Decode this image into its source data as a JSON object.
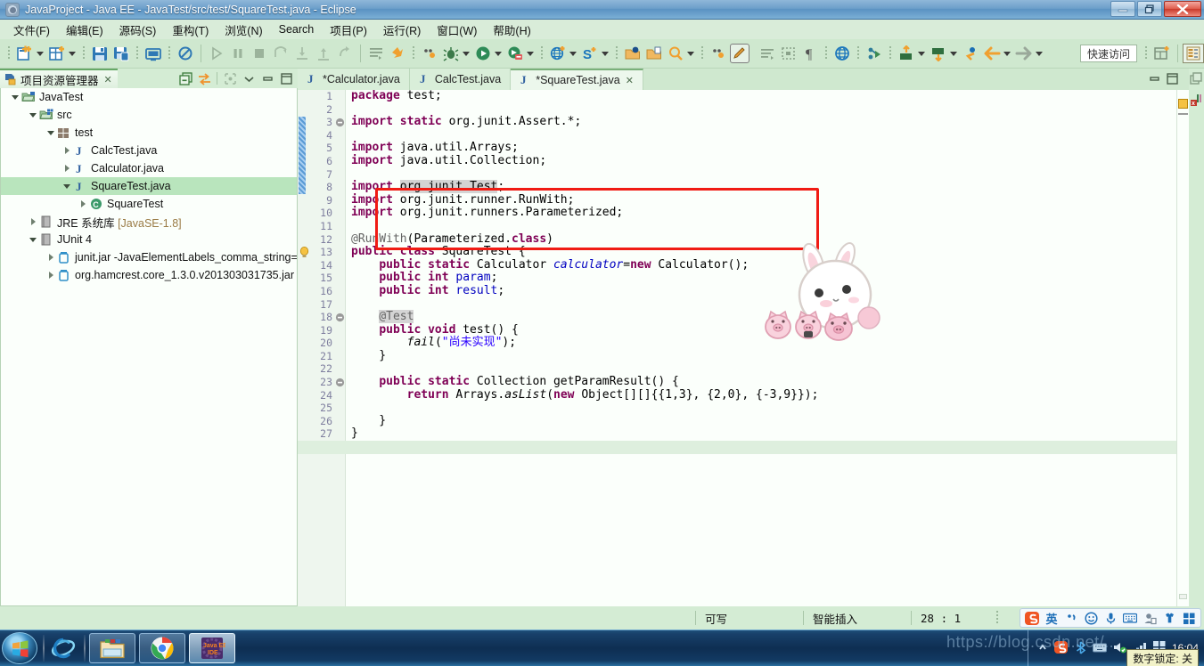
{
  "window": {
    "title": "JavaProject  -  Java EE  -  JavaTest/src/test/SquareTest.java  -  Eclipse",
    "app_icon": "eclipse-icon",
    "controls": {
      "minimize": "–",
      "restore": "❐",
      "close": "✕"
    }
  },
  "menubar": {
    "items": [
      "文件(F)",
      "编辑(E)",
      "源码(S)",
      "重构(T)",
      "浏览(N)",
      "Search",
      "项目(P)",
      "运行(R)",
      "窗口(W)",
      "帮助(H)"
    ]
  },
  "toolbar": {
    "quick_access_placeholder": "快速访问",
    "icons": [
      "new-wizard-icon",
      "new-dropdown-caret",
      "new-folder-icon",
      "new-folder-caret",
      "save-icon",
      "save-all-icon",
      "print-icon",
      "toggle-breakpoint-icon",
      "run-icon",
      "pause-icon",
      "stop-icon",
      "step-over-icon",
      "step-into-icon",
      "step-return-icon",
      "step-out-icon",
      "open-task-icon",
      "link-task-icon",
      "more-icon",
      "debug-icon",
      "debug-caret",
      "run-as-icon",
      "run-as-caret",
      "coverage-icon",
      "coverage-caret",
      "new-web-icon",
      "new-web-caret",
      "new-server-icon",
      "new-server-caret",
      "open-type-icon",
      "open-resource-icon",
      "search-icon",
      "search-caret",
      "more2-icon",
      "pencil-icon",
      "next-annotation-icon",
      "previous-annotation-icon",
      "pilcrow-icon",
      "globe-icon",
      "deploy-icon",
      "export-icon",
      "export-caret",
      "import-icon",
      "import-caret",
      "back-dot-icon",
      "back-arrow-icon",
      "back-caret",
      "forward-arrow-icon",
      "forward-caret"
    ],
    "perspective_new": "open-perspective-icon",
    "perspective_current": "java-ee-perspective-icon"
  },
  "project_explorer": {
    "tab_label": "项目资源管理器",
    "tab_close": "✕",
    "tools": [
      "collapse-all-icon",
      "link-with-editor-icon",
      "focus-on-active-task-icon",
      "view-menu-chevron-icon",
      "minimize-view-icon",
      "maximize-view-icon"
    ],
    "tree": [
      {
        "label": "JavaTest",
        "dim": "",
        "depth": 0,
        "twist": "open",
        "icon": "java-project-icon",
        "selected": false
      },
      {
        "label": "src",
        "dim": "",
        "depth": 1,
        "twist": "open",
        "icon": "source-folder-icon",
        "selected": false
      },
      {
        "label": "test",
        "dim": "",
        "depth": 2,
        "twist": "open",
        "icon": "package-icon",
        "selected": false
      },
      {
        "label": "CalcTest.java",
        "dim": "",
        "depth": 3,
        "twist": "closed",
        "icon": "java-file-icon",
        "selected": false
      },
      {
        "label": "Calculator.java",
        "dim": "",
        "depth": 3,
        "twist": "closed",
        "icon": "java-file-icon",
        "selected": false
      },
      {
        "label": "SquareTest.java",
        "dim": "",
        "depth": 3,
        "twist": "open",
        "icon": "java-file-icon",
        "selected": true
      },
      {
        "label": "SquareTest",
        "dim": "",
        "depth": 4,
        "twist": "closed",
        "icon": "java-class-icon",
        "selected": false
      },
      {
        "label": "JRE 系统库 ",
        "dim": "[JavaSE-1.8]",
        "depth": 1,
        "twist": "closed",
        "icon": "library-icon",
        "selected": false
      },
      {
        "label": "JUnit 4",
        "dim": "",
        "depth": 1,
        "twist": "open",
        "icon": "library-icon",
        "selected": false
      },
      {
        "label": "junit.jar -JavaElementLabels_comma_string=",
        "dim": "",
        "depth": 2,
        "twist": "closed",
        "icon": "jar-icon",
        "selected": false
      },
      {
        "label": "org.hamcrest.core_1.3.0.v201303031735.jar",
        "dim": "",
        "depth": 2,
        "twist": "closed",
        "icon": "jar-icon",
        "selected": false
      }
    ]
  },
  "editor": {
    "tabs": [
      {
        "label": "*Calculator.java",
        "icon": "java-file-icon",
        "active": false,
        "closable": false
      },
      {
        "label": "CalcTest.java",
        "icon": "java-file-icon",
        "active": false,
        "closable": false
      },
      {
        "label": "*SquareTest.java",
        "icon": "java-file-icon",
        "active": true,
        "closable": true
      }
    ],
    "minimize_icon": "minimize-editor-icon",
    "maximize_icon": "maximize-editor-icon",
    "current_line": 28,
    "error_box_lines": [
      23,
      26
    ],
    "lines": [
      {
        "n": 1,
        "fold": "",
        "marker": "",
        "html": "<span class=\"kw\">package</span> test;"
      },
      {
        "n": 2,
        "fold": "",
        "marker": "",
        "html": ""
      },
      {
        "n": 3,
        "fold": "minus",
        "marker": "",
        "html": "<span class=\"kw\">import static</span> org.junit.Assert.*;"
      },
      {
        "n": 4,
        "fold": "",
        "marker": "",
        "html": ""
      },
      {
        "n": 5,
        "fold": "",
        "marker": "",
        "html": "<span class=\"kw\">import</span> java.util.Arrays;"
      },
      {
        "n": 6,
        "fold": "",
        "marker": "",
        "html": "<span class=\"kw\">import</span> java.util.Collection;"
      },
      {
        "n": 7,
        "fold": "",
        "marker": "",
        "html": ""
      },
      {
        "n": 8,
        "fold": "",
        "marker": "",
        "html": "<span class=\"kw\">import</span> <span class=\"hl\">org.junit.Test</span>;"
      },
      {
        "n": 9,
        "fold": "",
        "marker": "",
        "html": "<span class=\"kw\">import</span> org.junit.runner.RunWith;"
      },
      {
        "n": 10,
        "fold": "",
        "marker": "",
        "html": "<span class=\"kw\">import</span> org.junit.runners.Parameterized;"
      },
      {
        "n": 11,
        "fold": "",
        "marker": "",
        "html": ""
      },
      {
        "n": 12,
        "fold": "",
        "marker": "",
        "html": "<span class=\"ann\">@RunWith</span>(Parameterized.<span class=\"kw\">class</span>)"
      },
      {
        "n": 13,
        "fold": "",
        "marker": "",
        "html": "<span class=\"kw\">public class</span> SquareTest {"
      },
      {
        "n": 14,
        "fold": "",
        "marker": "",
        "html": "    <span class=\"kw\">public static</span> Calculator <span class=\"fld stat\">calculator</span>=<span class=\"kw\">new</span> Calculator();"
      },
      {
        "n": 15,
        "fold": "",
        "marker": "",
        "html": "    <span class=\"kw\">public int</span> <span class=\"fld\">param</span>;"
      },
      {
        "n": 16,
        "fold": "",
        "marker": "",
        "html": "    <span class=\"kw\">public int</span> <span class=\"fld\">result</span>;"
      },
      {
        "n": 17,
        "fold": "",
        "marker": "",
        "html": ""
      },
      {
        "n": 18,
        "fold": "minus",
        "marker": "",
        "html": "    <span class=\"ann hl\">@Test</span>"
      },
      {
        "n": 19,
        "fold": "",
        "marker": "",
        "html": "    <span class=\"kw\">public void</span> test() {"
      },
      {
        "n": 20,
        "fold": "",
        "marker": "",
        "html": "        <span class=\"stat\">fail</span>(<span class=\"str\">\"尚未实现\"</span>);"
      },
      {
        "n": 21,
        "fold": "",
        "marker": "",
        "html": "    }"
      },
      {
        "n": 22,
        "fold": "",
        "marker": "",
        "html": ""
      },
      {
        "n": 23,
        "fold": "minus",
        "marker": "bulb",
        "html": "    <span class=\"kw\">public static</span> Collection getParamResult() {"
      },
      {
        "n": 24,
        "fold": "",
        "marker": "",
        "html": "        <span class=\"kw\">return</span> Arrays.<span class=\"stat\">asList</span>(<span class=\"kw\">new</span> Object[][]{{1,3}, {2,0}, {-3,9}});"
      },
      {
        "n": 25,
        "fold": "",
        "marker": "",
        "html": ""
      },
      {
        "n": 26,
        "fold": "",
        "marker": "",
        "html": "    }"
      },
      {
        "n": 27,
        "fold": "",
        "marker": "",
        "html": "}"
      },
      {
        "n": 28,
        "fold": "",
        "marker": "",
        "html": ""
      }
    ]
  },
  "statusbar": {
    "writable": "可写",
    "insert_mode": "智能插入",
    "position": "28 : 1"
  },
  "ime": {
    "logo": "sogou-pinyin-icon",
    "mode": "英",
    "icons": [
      "punctuation-icon",
      "emoji-icon",
      "voice-input-icon",
      "soft-keyboard-icon",
      "user-icon",
      "skin-icon",
      "toolbox-icon"
    ]
  },
  "taskbar": {
    "start": "start-orb",
    "quick_launch": [
      {
        "name": "internet-explorer-icon"
      }
    ],
    "buttons": [
      {
        "name": "file-explorer-taskbar-button",
        "icon": "folder-icon",
        "active": false
      },
      {
        "name": "chrome-taskbar-button",
        "icon": "chrome-icon",
        "active": false
      },
      {
        "name": "eclipse-taskbar-button",
        "icon": "java-ee-ide-icon",
        "label": "Java EE\nIDE",
        "active": true
      }
    ],
    "tray_icons": [
      "show-hidden-icon",
      "sogou-tray-icon",
      "bluetooth-icon",
      "keyboard-tray-icon",
      "volume-icon",
      "network-icon",
      "action-center-icon"
    ],
    "clock_time": "16:04",
    "numlock_tooltip": "数字锁定: 关"
  },
  "overlays": {
    "mascot": "bunny-with-pigs-sticker",
    "watermark": "https://blog.csdn.net/..."
  },
  "colors": {
    "titlebar_blue": "#5a92c2",
    "eclipse_green": "#cfe8cf",
    "selection_green": "#b9e5bd",
    "error_box_red": "#f01c14",
    "keyword_purple": "#7f0055",
    "string_blue": "#2a00ff",
    "field_blue": "#0000c0",
    "annotation_gray": "#646464",
    "current_line": "#deefde",
    "taskbar_blue": "#123a63"
  }
}
